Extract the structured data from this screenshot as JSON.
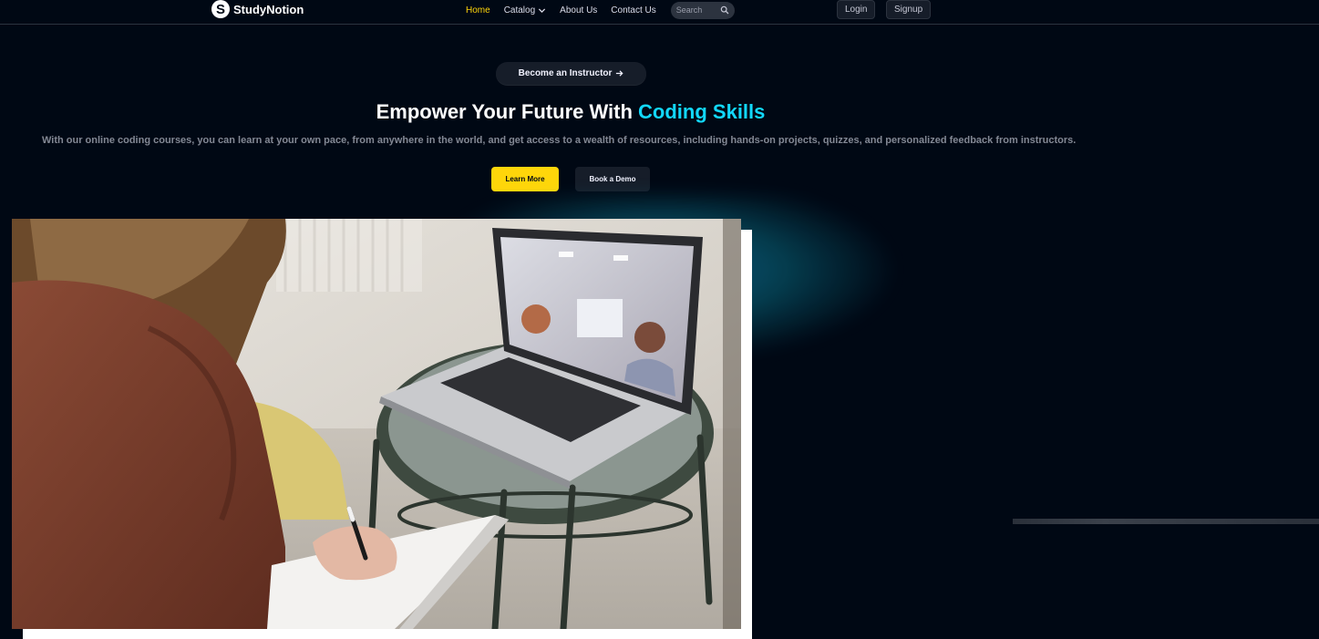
{
  "brand": {
    "name": "StudyNotion",
    "mark": "S"
  },
  "nav": {
    "links": [
      {
        "label": "Home",
        "active": true
      },
      {
        "label": "Catalog",
        "dropdown": true
      },
      {
        "label": "About Us"
      },
      {
        "label": "Contact Us"
      }
    ],
    "search": {
      "placeholder": "Search",
      "icon": "search-icon"
    },
    "login_label": "Login",
    "signup_label": "Signup"
  },
  "hero": {
    "instructor_label": "Become an Instructor",
    "title_prefix": "Empower Your Future With ",
    "title_highlight": "Coding Skills",
    "subtitle": "With our online coding courses, you can learn at your own pace, from anywhere in the world, and get access to a wealth of resources, including hands-on projects, quizzes, and personalized feedback from instructors.",
    "learn_more_label": "Learn More",
    "book_demo_label": "Book a Demo"
  },
  "colors": {
    "background": "#000814",
    "accent_yellow": "#ffd60a",
    "accent_cyan": "#12d8fa",
    "surface": "#161d29"
  }
}
